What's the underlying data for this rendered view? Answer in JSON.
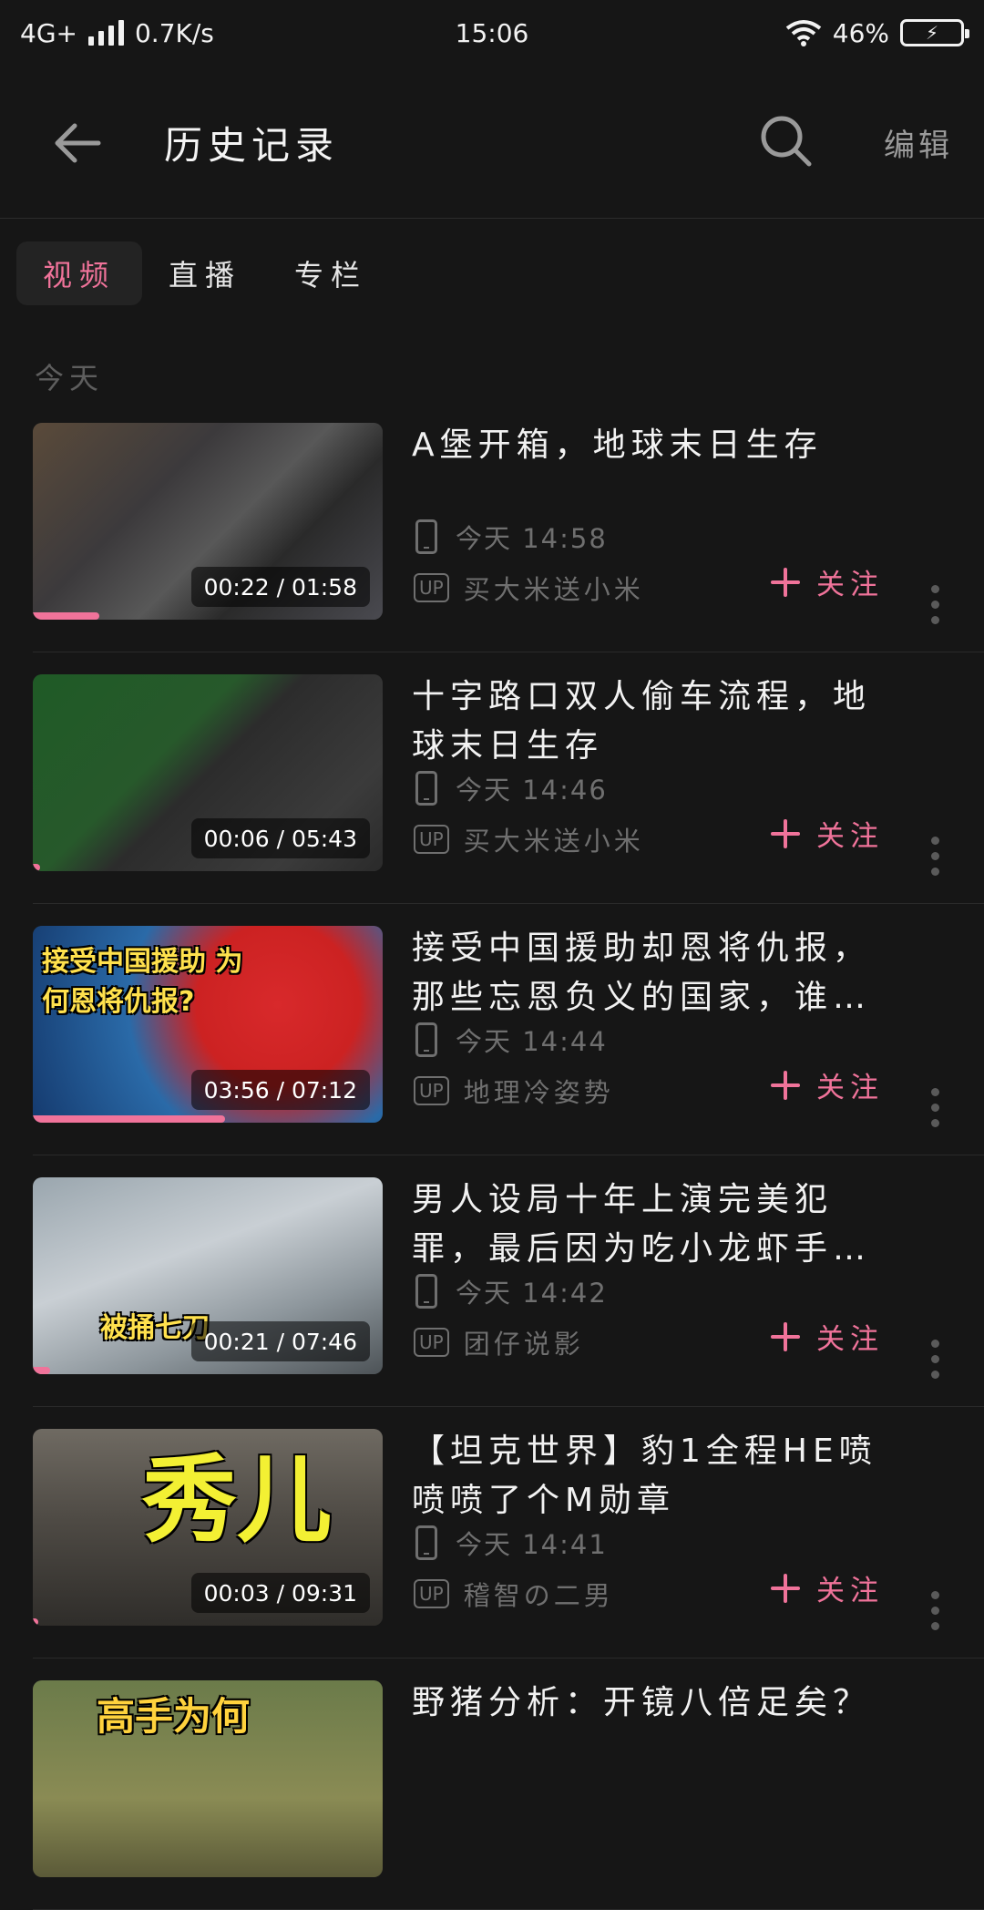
{
  "status_bar": {
    "network": "4G+",
    "speed": "0.7K/s",
    "time": "15:06",
    "battery": "46%"
  },
  "header": {
    "title": "历史记录",
    "edit_label": "编辑"
  },
  "tabs": [
    {
      "label": "视频",
      "active": true
    },
    {
      "label": "直播",
      "active": false
    },
    {
      "label": "专栏",
      "active": false
    }
  ],
  "section": {
    "label": "今天"
  },
  "colors": {
    "accent": "#f0739a",
    "background": "#161616"
  },
  "follow_label": "关注",
  "up_badge": "UP",
  "items": [
    {
      "title": "A堡开箱，地球末日生存",
      "time": "今天 14:58",
      "uploader": "买大米送小米",
      "duration": "00:22 / 01:58",
      "progress": 0.19,
      "caption": ""
    },
    {
      "title": "十字路口双人偷车流程，地球末日生存",
      "time": "今天 14:46",
      "uploader": "买大米送小米",
      "duration": "00:06 / 05:43",
      "progress": 0.02,
      "caption": ""
    },
    {
      "title": "接受中国援助却恩将仇报，那些忘恩负义的国家，谁…",
      "time": "今天 14:44",
      "uploader": "地理冷姿势",
      "duration": "03:56 / 07:12",
      "progress": 0.55,
      "caption": "接受中国援助 为何恩将仇报?"
    },
    {
      "title": "男人设局十年上演完美犯罪，最后因为吃小龙虾手…",
      "time": "今天 14:42",
      "uploader": "团仔说影",
      "duration": "00:21 / 07:46",
      "progress": 0.05,
      "caption": "被捅七刀"
    },
    {
      "title": "【坦克世界】豹1全程HE喷喷喷了个M勋章",
      "time": "今天 14:41",
      "uploader": "稽智の二男",
      "duration": "00:03 / 09:31",
      "progress": 0.0,
      "caption": "秀儿"
    },
    {
      "title": "野猪分析：开镜八倍足矣？",
      "time": "",
      "uploader": "",
      "duration": "",
      "progress": 0.0,
      "caption": "高手为何"
    }
  ]
}
